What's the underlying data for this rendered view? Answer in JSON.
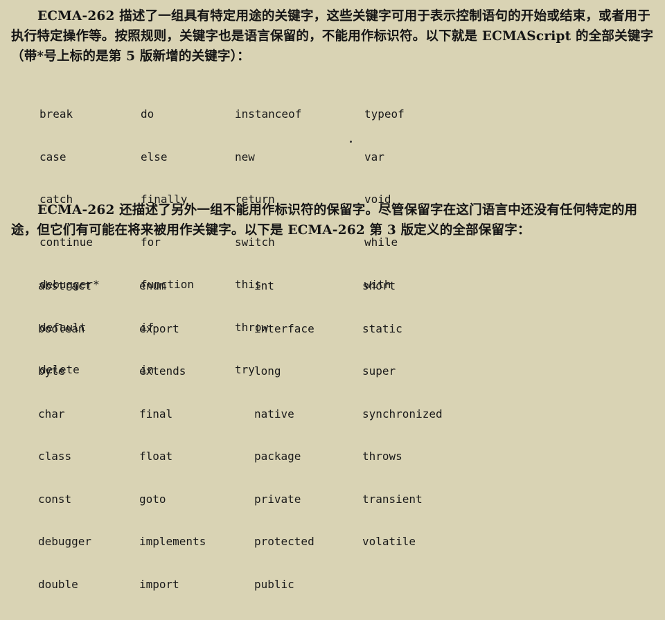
{
  "paragraph1": {
    "text_a": "ECMA-262 描述了一组具有特定用途的",
    "emphasis": "关键字",
    "text_b": "，这些关键字可用于表示控制语句的开始或结束，或者用于执行特定操作等。按照规则，关键字也是语言保留的，不能用作标识符。以下就是 ECMAScript 的全部关键字（带*号上标的是第 5 版新增的关键字）："
  },
  "keywords": {
    "columns": [
      [
        "break",
        "case",
        "catch",
        "continue",
        "debugger*",
        "default",
        "delete"
      ],
      [
        "do",
        "else",
        "finally",
        "for",
        "function",
        "if",
        "in"
      ],
      [
        "instanceof",
        "new",
        "return",
        "switch",
        "this",
        "throw",
        "try"
      ],
      [
        "typeof",
        "var",
        "void",
        "while",
        "with"
      ]
    ]
  },
  "paragraph2": {
    "text_a": "ECMA-262 还描述了另外一组不能用作标识符的",
    "emphasis": "保留字",
    "text_b": "。尽管保留字在这门语言中还没有任何特定的用途，但它们有可能在将来被用作关键字。以下是 ECMA-262 第 3 版定义的全部保留字："
  },
  "reserved_words": {
    "columns": [
      [
        "abstract",
        "boolean",
        "byte",
        "char",
        "class",
        "const",
        "debugger",
        "double"
      ],
      [
        "enum",
        "export",
        "extends",
        "final",
        "float",
        "goto",
        "implements",
        "import"
      ],
      [
        "int",
        "interface",
        "long",
        "native",
        "package",
        "private",
        "protected",
        "public"
      ],
      [
        "short",
        "static",
        "super",
        "synchronized",
        "throws",
        "transient",
        "volatile"
      ]
    ]
  }
}
